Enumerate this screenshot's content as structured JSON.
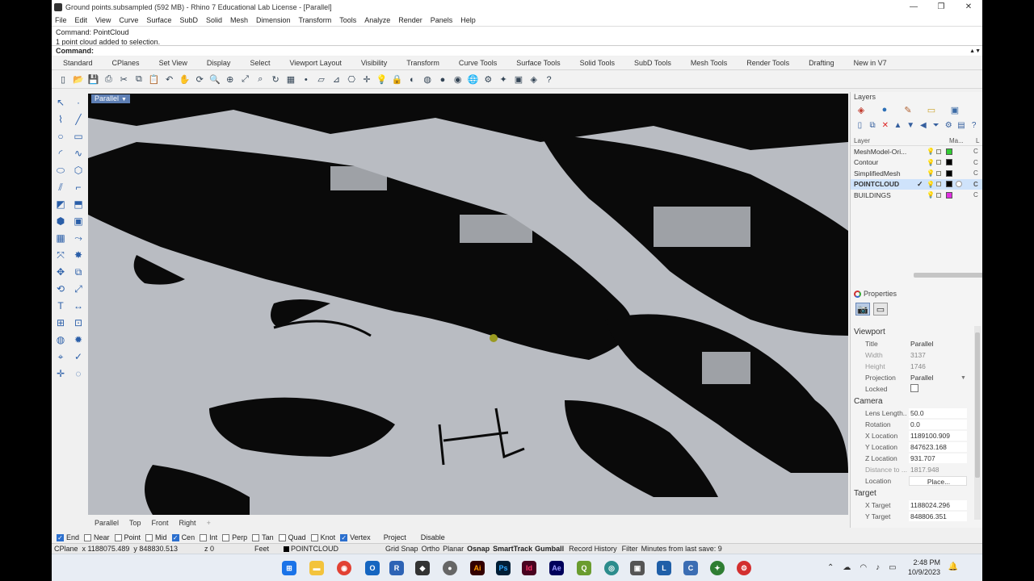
{
  "window": {
    "title": "Ground points.subsampled (592 MB) - Rhino 7 Educational Lab License - [Parallel]",
    "controls": [
      "—",
      "❐",
      "✕"
    ]
  },
  "menu": [
    "File",
    "Edit",
    "View",
    "Curve",
    "Surface",
    "SubD",
    "Solid",
    "Mesh",
    "Dimension",
    "Transform",
    "Tools",
    "Analyze",
    "Render",
    "Panels",
    "Help"
  ],
  "command_history": [
    "Command: PointCloud",
    "1 point cloud added to selection."
  ],
  "command_prompt": "Command:",
  "toolbar_tabs": [
    "Standard",
    "CPlanes",
    "Set View",
    "Display",
    "Select",
    "Viewport Layout",
    "Visibility",
    "Transform",
    "Curve Tools",
    "Surface Tools",
    "Solid Tools",
    "SubD Tools",
    "Mesh Tools",
    "Render Tools",
    "Drafting",
    "New in V7"
  ],
  "toolbar_icons": [
    "new-icon",
    "open-icon",
    "save-icon",
    "print-icon",
    "cut-icon",
    "copy-icon",
    "paste-icon",
    "undo-icon",
    "pan-icon",
    "rotate-icon",
    "zoom-icon",
    "zoom-window-icon",
    "zoom-extents-icon",
    "zoom-selected-icon",
    "undo-view-icon",
    "four-viewports-icon",
    "point-icon",
    "cplane-icon",
    "cplane-world-icon",
    "named-view-icon",
    "gumball-icon",
    "light-icon",
    "lock-icon",
    "material-icon",
    "color-wheel-icon",
    "render-sphere-icon",
    "shaded-sphere-icon",
    "globe-icon",
    "options-icon",
    "grasshopper-icon",
    "plugin-icon",
    "map-icon",
    "help-icon"
  ],
  "viewport": {
    "label": "Parallel",
    "tabs": [
      "Parallel",
      "Top",
      "Front",
      "Right"
    ],
    "add_tab": "+"
  },
  "osnaps": [
    {
      "label": "End",
      "on": true
    },
    {
      "label": "Near",
      "on": false
    },
    {
      "label": "Point",
      "on": false
    },
    {
      "label": "Mid",
      "on": false
    },
    {
      "label": "Cen",
      "on": true
    },
    {
      "label": "Int",
      "on": false
    },
    {
      "label": "Perp",
      "on": false
    },
    {
      "label": "Tan",
      "on": false
    },
    {
      "label": "Quad",
      "on": false
    },
    {
      "label": "Knot",
      "on": false
    },
    {
      "label": "Vertex",
      "on": true
    },
    {
      "label": "Project",
      "on": false
    },
    {
      "label": "Disable",
      "on": false
    }
  ],
  "status": {
    "cplane": "CPlane",
    "x": "x 1188075.489",
    "y": "y 848830.513",
    "z": "z 0",
    "units": "Feet",
    "layer": "POINTCLOUD",
    "grid_snap": "Grid Snap",
    "ortho": "Ortho",
    "planar": "Planar",
    "osnap": "Osnap",
    "smarttrack": "SmartTrack",
    "gumball": "Gumball",
    "record_history": "Record History",
    "filter": "Filter",
    "last_save": "Minutes from last save: 9"
  },
  "layers_panel": {
    "title": "Layers",
    "col_layer": "Layer",
    "col_material": "Ma...",
    "col_extra": "L",
    "layers": [
      {
        "name": "MeshModel-Ori...",
        "color": "#33cc33",
        "current": false,
        "extra": "C"
      },
      {
        "name": "Contour",
        "color": "#000000",
        "current": false,
        "extra": "C"
      },
      {
        "name": "SimplifiedMesh",
        "color": "#000000",
        "current": false,
        "extra": "C"
      },
      {
        "name": "POINTCLOUD",
        "color": "#000000",
        "current": true,
        "extra": "C"
      },
      {
        "name": "BUILDINGS",
        "color": "#e030e0",
        "current": false,
        "extra": "C"
      }
    ]
  },
  "properties_panel": {
    "title": "Properties",
    "viewport_section": "Viewport",
    "viewport_rows": [
      {
        "key": "Title",
        "value": "Parallel",
        "style": "plain"
      },
      {
        "key": "Width",
        "value": "3137",
        "style": "dim"
      },
      {
        "key": "Height",
        "value": "1746",
        "style": "dim"
      },
      {
        "key": "Projection",
        "value": "Parallel",
        "style": "dropdown"
      }
    ],
    "locked_label": "Locked",
    "camera_section": "Camera",
    "camera_rows": [
      {
        "key": "Lens Length...",
        "value": "50.0",
        "style": "box"
      },
      {
        "key": "Rotation",
        "value": "0.0",
        "style": "box"
      },
      {
        "key": "X Location",
        "value": "1189100.909",
        "style": "box"
      },
      {
        "key": "Y Location",
        "value": "847623.168",
        "style": "box"
      },
      {
        "key": "Z Location",
        "value": "931.707",
        "style": "box"
      },
      {
        "key": "Distance to ...",
        "value": "1817.948",
        "style": "dim"
      },
      {
        "key": "Location",
        "value": "Place...",
        "style": "button"
      }
    ],
    "target_section": "Target",
    "target_rows": [
      {
        "key": "X Target",
        "value": "1188024.296",
        "style": "box"
      },
      {
        "key": "Y Target",
        "value": "848806.351",
        "style": "box"
      }
    ]
  },
  "taskbar": {
    "time": "2:48 PM",
    "date": "10/9/2023"
  }
}
